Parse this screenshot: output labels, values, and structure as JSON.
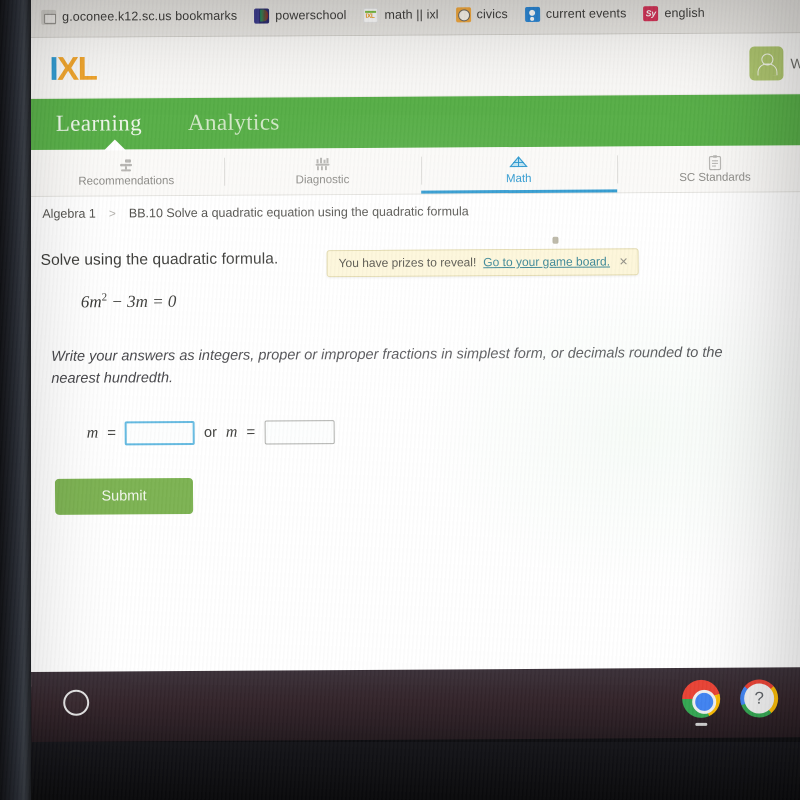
{
  "browser": {
    "bookmarks": [
      {
        "label": "g.oconee.k12.sc.us bookmarks",
        "icon": "folder-icon"
      },
      {
        "label": "powerschool",
        "icon": "powerschool-icon"
      },
      {
        "label": "math || ixl",
        "icon": "ixl-icon"
      },
      {
        "label": "civics",
        "icon": "civics-icon"
      },
      {
        "label": "current events",
        "icon": "person-icon"
      },
      {
        "label": "english",
        "icon": "syllabus-icon"
      }
    ]
  },
  "header": {
    "logo_i": "I",
    "logo_x": "X",
    "logo_l": "L",
    "avatar_icon": "user-avatar-icon",
    "user_name": "W"
  },
  "green_nav": {
    "items": [
      {
        "label": "Learning",
        "active": true
      },
      {
        "label": "Analytics",
        "active": false
      }
    ]
  },
  "subtabs": [
    {
      "label": "Recommendations",
      "icon": "recommendations-icon",
      "active": false
    },
    {
      "label": "Diagnostic",
      "icon": "diagnostic-icon",
      "active": false
    },
    {
      "label": "Math",
      "icon": "math-diamond-icon",
      "active": true
    },
    {
      "label": "SC Standards",
      "icon": "clipboard-icon",
      "active": false
    }
  ],
  "breadcrumb": {
    "course": "Algebra 1",
    "separator": ">",
    "skill": "BB.10 Solve a quadratic equation using the quadratic formula"
  },
  "prize_toast": {
    "message": "You have prizes to reveal!",
    "link": "Go to your game board.",
    "close": "✕"
  },
  "question": {
    "prompt": "Solve using the quadratic formula.",
    "equation_coefficient": "6",
    "equation_var": "m",
    "equation_exponent": "2",
    "equation_rest": " − 3",
    "equation_var2": "m",
    "equation_equals": " = 0",
    "note": "Write your answers as integers, proper or improper fractions in simplest form, or decimals rounded to the nearest hundredth.",
    "answer_label_1": "m",
    "equals_1": "=",
    "answer_value_1": "",
    "answer_placeholder_1": "",
    "or_text": "or",
    "answer_label_2": "m",
    "equals_2": "=",
    "answer_value_2": "",
    "answer_placeholder_2": "",
    "submit_label": "Submit"
  },
  "shelf": {
    "launcher_icon": "launcher-circle-icon",
    "chrome_icon": "chrome-icon",
    "help_icon": "help-icon"
  },
  "colors": {
    "green_nav": "#57ae47",
    "submit_green": "#7cb252",
    "accent_blue": "#2f9ad0",
    "toast_yellow": "#fdf6d8",
    "logo_blue": "#2f9ad0",
    "logo_orange": "#f1a52c"
  }
}
